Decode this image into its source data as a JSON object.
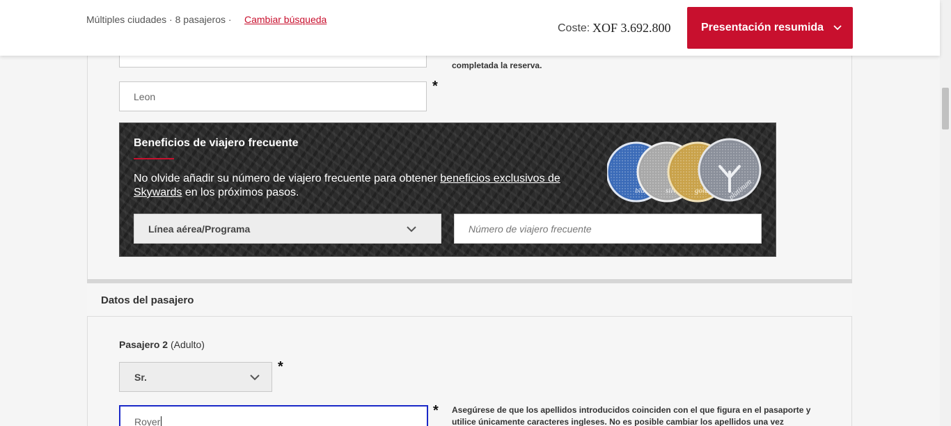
{
  "header": {
    "search_summary": "Múltiples ciudades · 8 pasajeros ·",
    "change_search": "Cambiar búsqueda",
    "cost_label": "Coste:",
    "cost_value": "XOF 3.692.800",
    "summary_button": "Presentación resumida"
  },
  "passenger1": {
    "surname_value": "Leon",
    "note_text": "completada la reserva."
  },
  "frequent_flyer": {
    "title": "Beneficios de viajero frecuente",
    "text_before": "No olvide añadir su número de viajero frecuente para obtener",
    "link_text": "beneficios exclusivos de Skywards",
    "text_after": "en los próximos pasos.",
    "airline_select": "Línea aérea/Programa",
    "number_placeholder": "Número de viajero frecuente",
    "medals": [
      {
        "label": "blue",
        "color": "#3b6bb8"
      },
      {
        "label": "silver",
        "color": "#a8a8a8"
      },
      {
        "label": "gold",
        "color": "#c9a24a"
      },
      {
        "label": "platinum",
        "color": "#8a8f9a"
      }
    ]
  },
  "section": {
    "title": "Datos del pasajero"
  },
  "passenger2": {
    "label_bold": "Pasajero 2",
    "label_extra": "(Adulto)",
    "title_value": "Sr.",
    "surname_value": "Royer",
    "note_text": "Asegúrese de que los apellidos introducidos coinciden con el que figura en el pasaporte y utilice únicamente caracteres ingleses. No es posible cambiar los apellidos una vez"
  },
  "required_mark": "*",
  "colors": {
    "brand_red": "#c8102e",
    "focus_blue": "#1a28c7"
  }
}
